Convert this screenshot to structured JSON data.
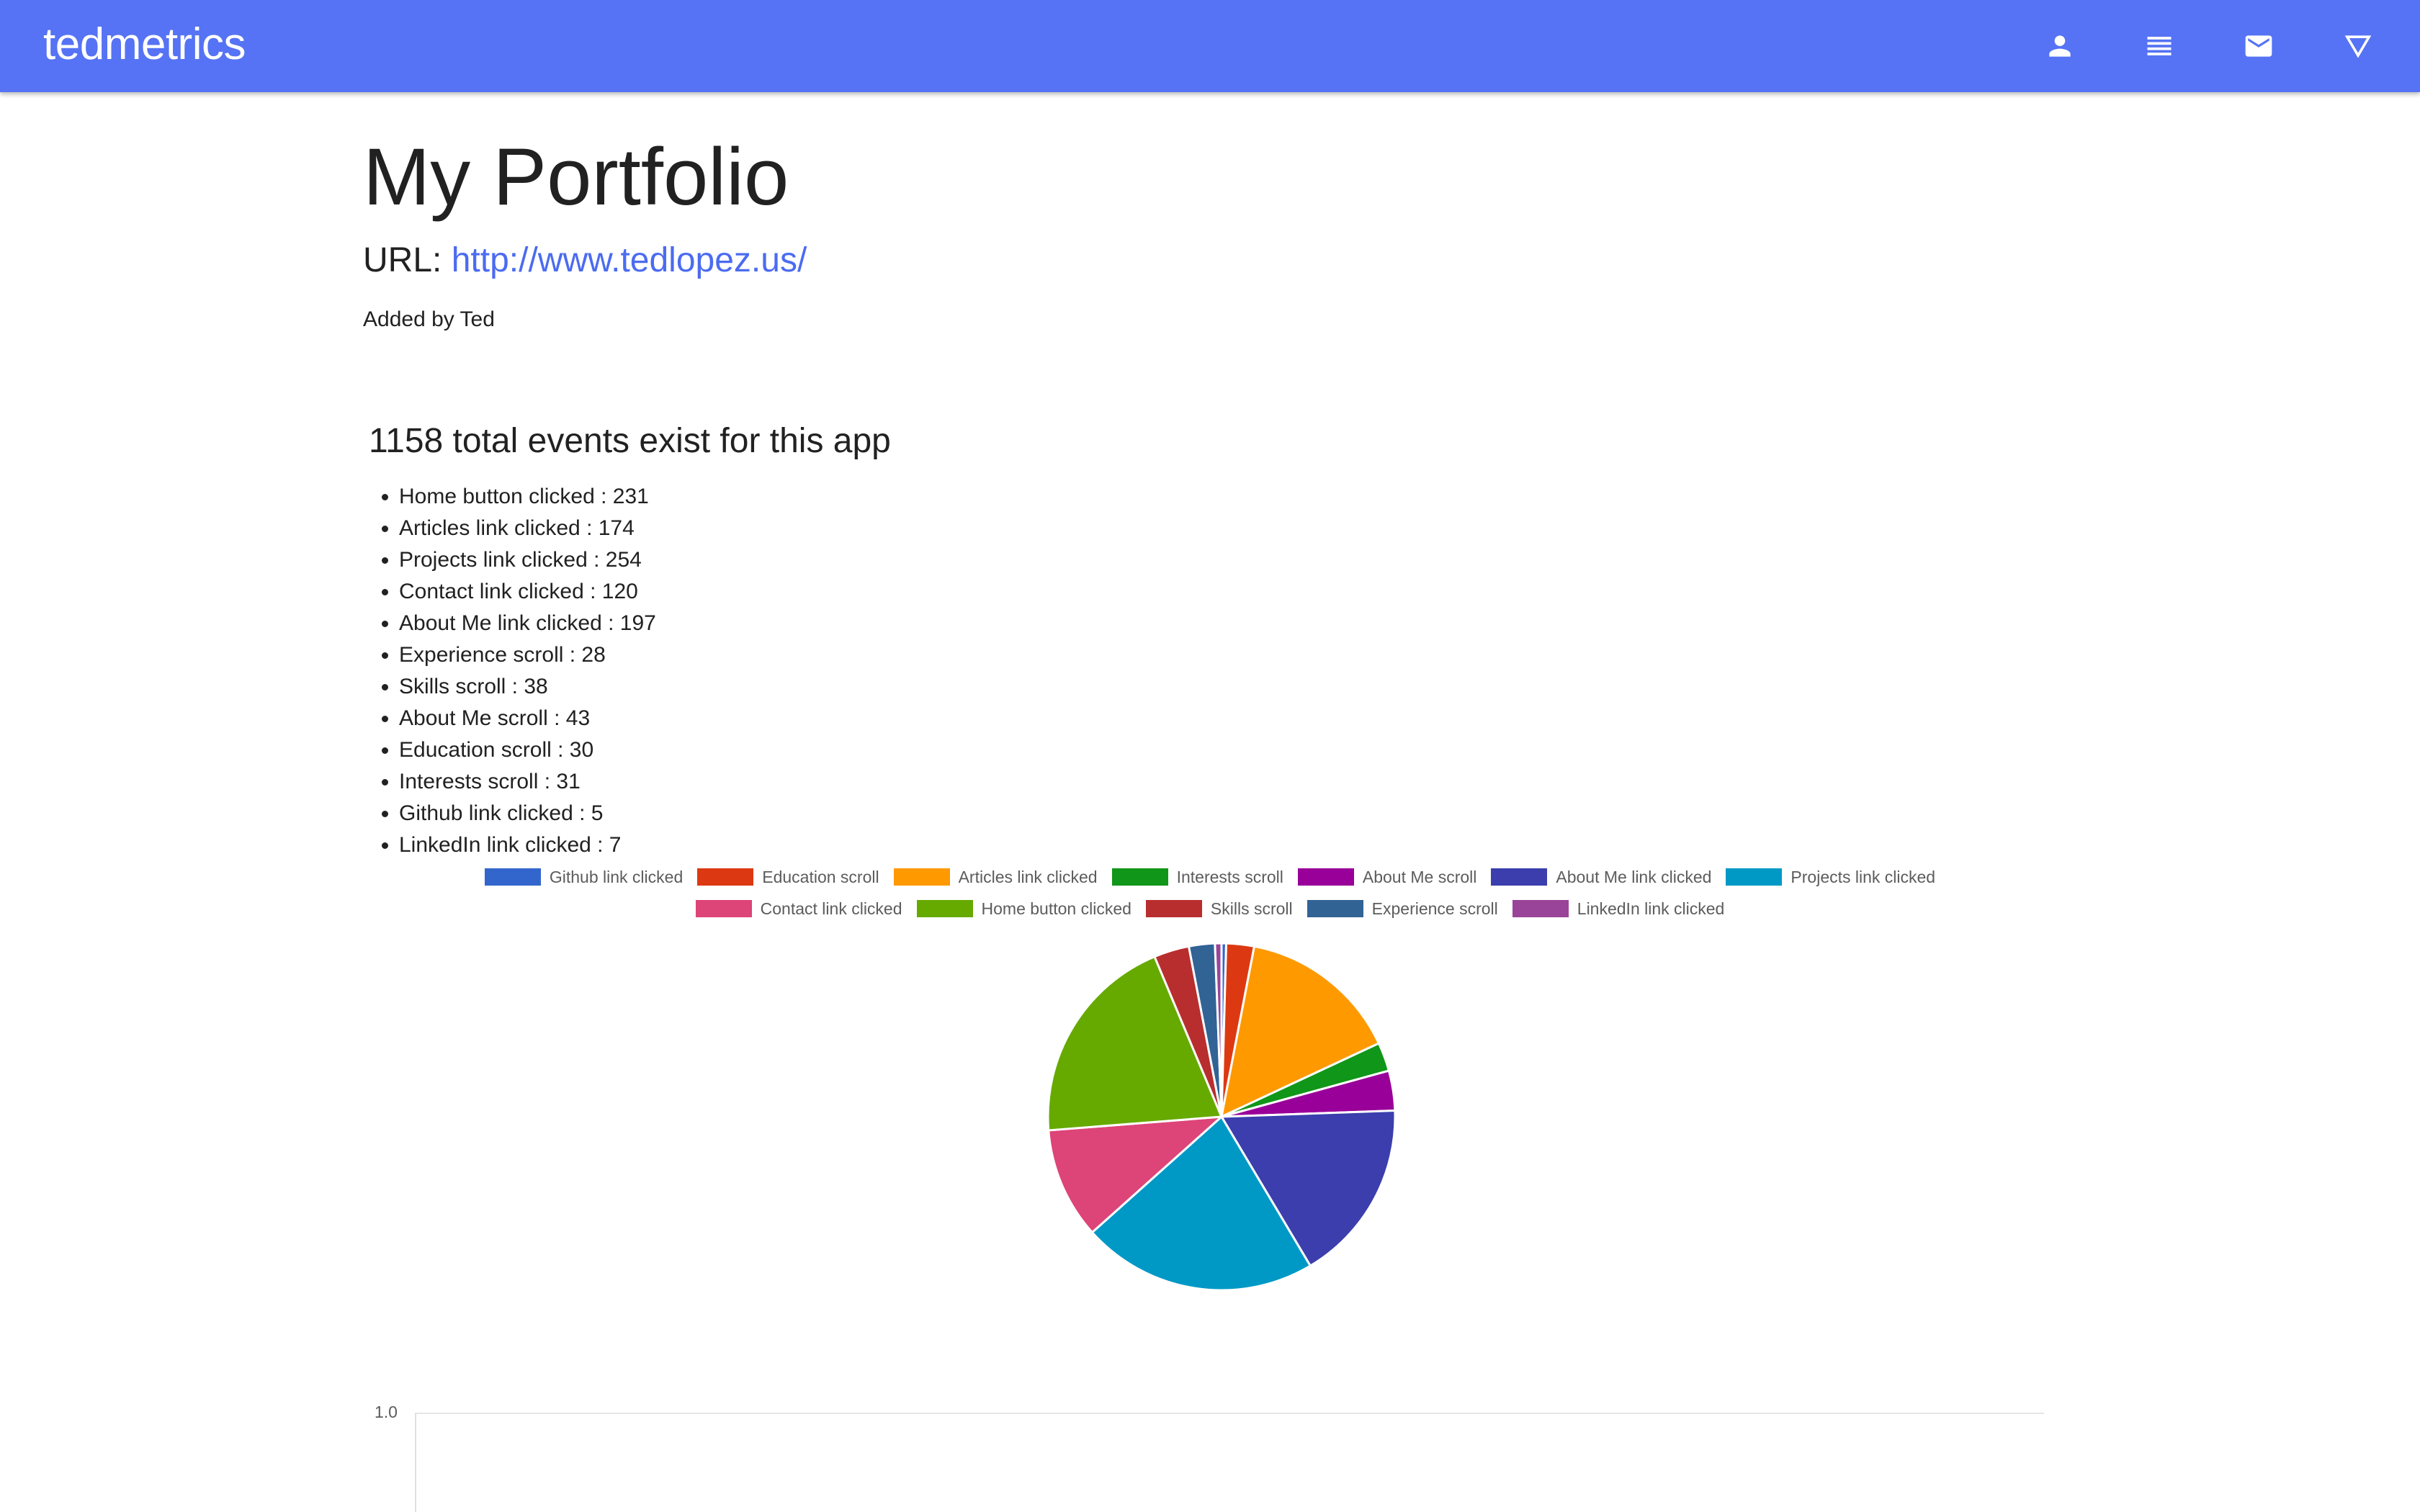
{
  "app": {
    "title": "tedmetrics",
    "nav_icons": [
      "person-icon",
      "list-icon",
      "mail-icon",
      "filter-icon"
    ]
  },
  "page": {
    "title": "My Portfolio",
    "url_label": "URL:",
    "url": "http://www.tedlopez.us/",
    "added_by": "Added by Ted"
  },
  "events": {
    "heading": "1158 total events exist for this app",
    "items": [
      "Home button clicked : 231",
      "Articles link clicked : 174",
      "Projects link clicked : 254",
      "Contact link clicked : 120",
      "About Me link clicked : 197",
      "Experience scroll : 28",
      "Skills scroll : 38",
      "About Me scroll : 43",
      "Education scroll : 30",
      "Interests scroll : 31",
      "Github link clicked : 5",
      "LinkedIn link clicked : 7"
    ]
  },
  "chart_data": [
    {
      "type": "pie",
      "legend_position": "top",
      "labels": [
        "Github link clicked",
        "Education scroll",
        "Articles link clicked",
        "Interests scroll",
        "About Me scroll",
        "About Me link clicked",
        "Projects link clicked",
        "Contact link clicked",
        "Home button clicked",
        "Skills scroll",
        "Experience scroll",
        "LinkedIn link clicked"
      ],
      "values": [
        5,
        30,
        174,
        31,
        43,
        197,
        254,
        120,
        231,
        38,
        28,
        7
      ],
      "colors": [
        "#3366cc",
        "#dc3912",
        "#ff9900",
        "#109618",
        "#990099",
        "#3b3eac",
        "#0099c6",
        "#dd4477",
        "#66aa00",
        "#b82e2e",
        "#316395",
        "#994499"
      ]
    },
    {
      "type": "line",
      "y_tick_labels": [
        "1.0"
      ],
      "grid": true
    }
  ],
  "colors": {
    "topbar": "#5573f4",
    "link": "#4b6bf0"
  }
}
